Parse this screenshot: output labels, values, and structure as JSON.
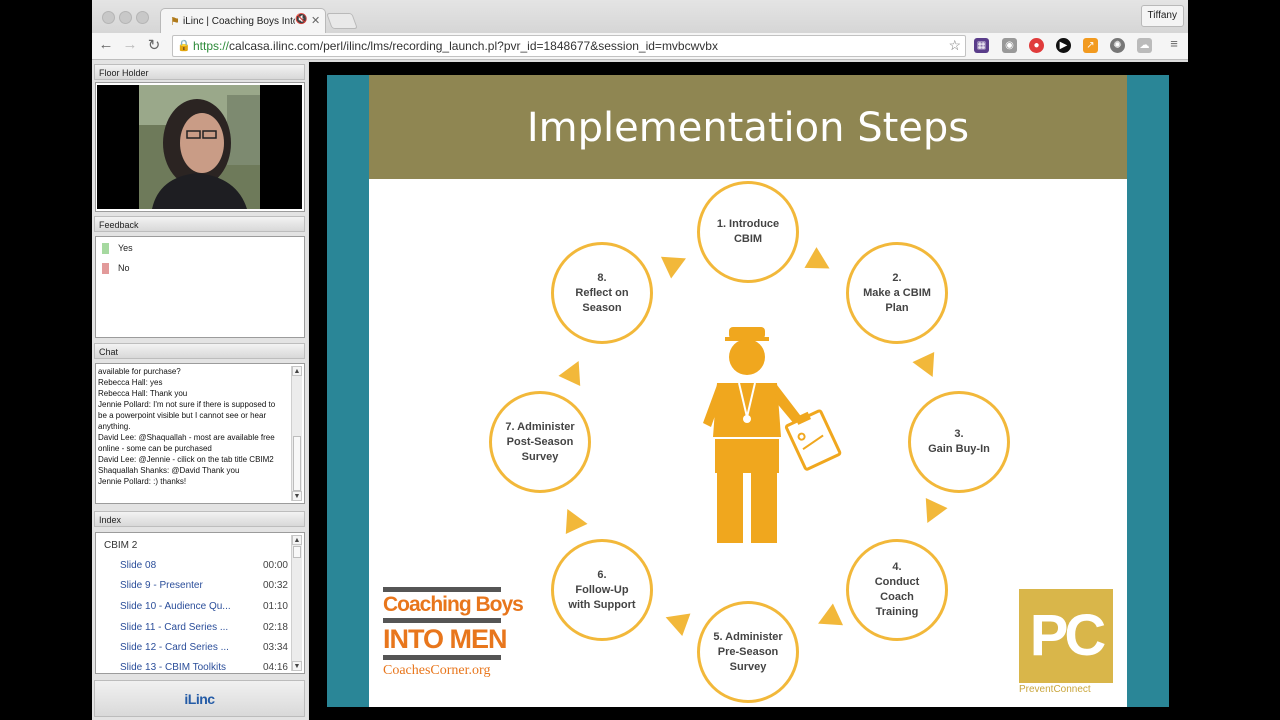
{
  "browser": {
    "tab_title": "iLinc | Coaching Boys Into Men",
    "profile_name": "Tiffany",
    "url_scheme": "https://",
    "url_rest": "calcasa.ilinc.com/perl/ilinc/lms/recording_launch.pl?pvr_id=1848677&session_id=mvbcwvbx"
  },
  "panels": {
    "floor_holder": "Floor Holder",
    "feedback": "Feedback",
    "chat": "Chat",
    "index": "Index"
  },
  "feedback": {
    "yes_label": "Yes",
    "no_label": "No",
    "yes_color": "#a6d9a0",
    "no_color": "#e29a9a"
  },
  "chat": {
    "messages": [
      "available for purchase?",
      "Rebecca  Hall: yes",
      "Rebecca  Hall: Thank you",
      "Jennie  Pollard: I'm not sure if there is supposed to be a powerpoint visible but I cannot see or hear anything.",
      "David Lee: @Shaquallah - most are available free online - some can be purchased",
      "David Lee: @Jennie - cilick on the tab title CBIM2",
      "Shaquallah Shanks: @David Thank you",
      "Jennie  Pollard: :) thanks!"
    ]
  },
  "index": {
    "group": "CBIM 2",
    "rows": [
      {
        "label": "Slide 08",
        "time": "00:00"
      },
      {
        "label": "Slide 9 - Presenter",
        "time": "00:32"
      },
      {
        "label": "Slide 10 - Audience Qu...",
        "time": "01:10"
      },
      {
        "label": "Slide 11 - Card Series ...",
        "time": "02:18"
      },
      {
        "label": "Slide 12 - Card Series ...",
        "time": "03:34"
      },
      {
        "label": "Slide 13 - CBIM Toolkits",
        "time": "04:16"
      }
    ]
  },
  "brand": {
    "ilinc": "iLinc"
  },
  "slide": {
    "title": "Implementation Steps",
    "steps": [
      "1. Introduce\nCBIM",
      "2.\nMake a CBIM\nPlan",
      "3.\nGain Buy-In",
      "4.\nConduct\nCoach\nTraining",
      "5. Administer\nPre-Season\nSurvey",
      "6.\nFollow-Up\nwith Support",
      "7. Administer\nPost-Season\nSurvey",
      "8.\nReflect on\nSeason"
    ],
    "cbim_logo": {
      "line1": "Coaching Boys",
      "line2": "INTO MEN",
      "line3": "CoachesCorner.org"
    },
    "pc_logo": {
      "mark": "PC",
      "name": "PreventConnect"
    },
    "colors": {
      "accent": "#f2b83a",
      "title_bar": "#8f8652",
      "side_band": "#2a8697",
      "figure": "#f0a71e"
    }
  }
}
